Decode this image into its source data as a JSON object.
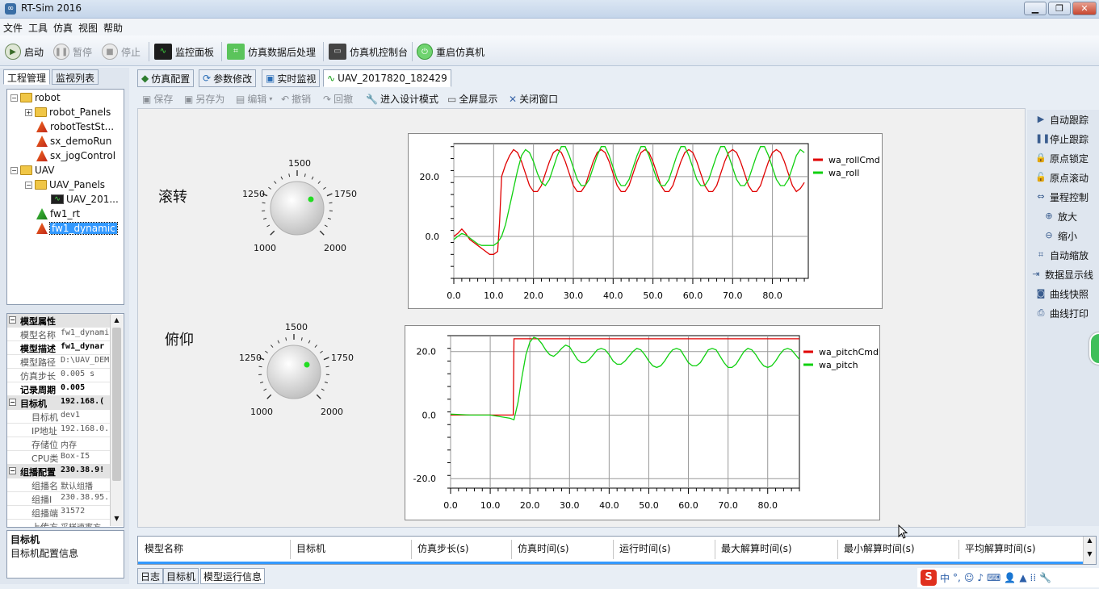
{
  "window": {
    "title": "RT-Sim 2016",
    "minimize": "▁",
    "restore": "❐",
    "close": "✕"
  },
  "menu": [
    "文件",
    "工具",
    "仿真",
    "视图",
    "帮助"
  ],
  "toolbar": {
    "start": "启动",
    "pause": "暂停",
    "stop": "停止",
    "monitor_panel": "监控面板",
    "postprocess": "仿真数据后处理",
    "console": "仿真机控制台",
    "restart": "重启仿真机"
  },
  "left_tabs": [
    "工程管理",
    "监视列表"
  ],
  "tree": {
    "robot": "robot",
    "robot_panels": "robot_Panels",
    "robot_test": "robotTestSt...",
    "sx_demo": "sx_demoRun",
    "sx_jog": "sx_jogControl",
    "uav": "UAV",
    "uav_panels": "UAV_Panels",
    "uav_201": "UAV_201...",
    "fw1_rt": "fw1_rt",
    "fw1_dynamic": "fw1_dynamic"
  },
  "props": [
    {
      "k": "模型属性",
      "v": "",
      "type": "grp"
    },
    {
      "k": "模型名称",
      "v": "fw1_dynami",
      "type": "n"
    },
    {
      "k": "模型描述",
      "v": "fw1_dynar",
      "type": "bold"
    },
    {
      "k": "模型路径",
      "v": "D:\\UAV_DEM",
      "type": "n"
    },
    {
      "k": "仿真步长",
      "v": "0.005 s",
      "type": "n"
    },
    {
      "k": "记录周期",
      "v": "0.005",
      "type": "bold"
    },
    {
      "k": "目标机",
      "v": "192.168.(",
      "type": "grp"
    },
    {
      "k": "目标机",
      "v": "dev1",
      "type": "n2"
    },
    {
      "k": "IP地址",
      "v": "192.168.0.",
      "type": "n2"
    },
    {
      "k": "存储位",
      "v": "内存",
      "type": "n2"
    },
    {
      "k": "CPU类",
      "v": "Box-I5",
      "type": "n2"
    },
    {
      "k": "组播配置",
      "v": "230.38.9!",
      "type": "grp"
    },
    {
      "k": "组播名",
      "v": "默认组播",
      "type": "n2"
    },
    {
      "k": "组播I",
      "v": "230.38.95.",
      "type": "n2"
    },
    {
      "k": "组播端",
      "v": "31572",
      "type": "n2"
    },
    {
      "k": "上传方",
      "v": "采样速率方",
      "type": "n2"
    }
  ],
  "desc": {
    "title": "目标机",
    "text": "目标机配置信息"
  },
  "main_tabs": [
    "仿真配置",
    "参数修改",
    "实时监视",
    "UAV_2017820_182429"
  ],
  "subtoolbar": {
    "save": "保存",
    "saveas": "另存为",
    "edit": "编辑",
    "undo": "撤销",
    "redo": "回撤",
    "design": "进入设计模式",
    "fullscreen": "全屏显示",
    "close": "关闭窗口"
  },
  "right_panel": [
    "自动跟踪",
    "停止跟踪",
    "原点锁定",
    "原点滚动",
    "量程控制",
    "放大",
    "缩小",
    "自动缩放",
    "数据显示线",
    "曲线快照",
    "曲线打印"
  ],
  "labels": {
    "roll": "滚转",
    "pitch": "俯仰"
  },
  "knob1": {
    "t": "1500",
    "l": "1250",
    "r": "1750",
    "bl": "1000",
    "br": "2000"
  },
  "knob2": {
    "t": "1500",
    "l": "1250",
    "r": "1750",
    "bl": "1000",
    "br": "2000"
  },
  "chart_data": [
    {
      "type": "line",
      "x_ticks": [
        0,
        10,
        20,
        30,
        40,
        50,
        60,
        70,
        80
      ],
      "y_ticks": [
        0,
        20
      ],
      "xlim": [
        0,
        89
      ],
      "ylim": [
        -14,
        31
      ],
      "legend": "top-right",
      "grid": true,
      "series": [
        {
          "name": "wa_rollCmd",
          "color": "#e00000",
          "x": [
            0,
            1,
            2,
            3,
            4,
            5,
            6,
            7,
            8,
            9,
            10,
            11,
            11.5,
            12,
            13,
            14,
            15,
            16,
            17,
            18,
            19,
            20,
            21,
            22,
            23,
            24,
            25,
            26,
            27,
            28,
            29,
            30,
            31,
            32,
            33,
            34,
            35,
            36,
            37,
            38,
            39,
            40,
            41,
            42,
            43,
            44,
            45,
            46,
            47,
            48,
            49,
            50,
            51,
            52,
            53,
            54,
            55,
            56,
            57,
            58,
            59,
            60,
            61,
            62,
            63,
            64,
            65,
            66,
            67,
            68,
            69,
            70,
            71,
            72,
            73,
            74,
            75,
            76,
            77,
            78,
            79,
            80,
            81,
            82,
            83,
            84,
            85,
            86,
            87,
            88
          ],
          "y": [
            0,
            1,
            2.5,
            1,
            -1,
            -2,
            -3,
            -4,
            -5,
            -6,
            -6,
            -5,
            5,
            20,
            24,
            27,
            29,
            28,
            25,
            21,
            17,
            15,
            15,
            17,
            21,
            25,
            28,
            29,
            28,
            25,
            21,
            17,
            15,
            15,
            17,
            21,
            25,
            28,
            29,
            28,
            25,
            21,
            17,
            15,
            15,
            17,
            21,
            25,
            28,
            29,
            28,
            25,
            21,
            17,
            15,
            15,
            17,
            21,
            25,
            28,
            29,
            28,
            25,
            21,
            17,
            15,
            15,
            17,
            21,
            25,
            28,
            29,
            28,
            25,
            21,
            17,
            15,
            15,
            17,
            21,
            25,
            28,
            29,
            28,
            25,
            21,
            17,
            15,
            16,
            18
          ]
        },
        {
          "name": "wa_roll",
          "color": "#10d010",
          "x": [
            0,
            1,
            2,
            3,
            4,
            5,
            6,
            7,
            8,
            9,
            10,
            11,
            12,
            13,
            14,
            15,
            16,
            17,
            18,
            19,
            20,
            21,
            22,
            23,
            24,
            25,
            26,
            27,
            28,
            29,
            30,
            31,
            32,
            33,
            34,
            35,
            36,
            37,
            38,
            39,
            40,
            41,
            42,
            43,
            44,
            45,
            46,
            47,
            48,
            49,
            50,
            51,
            52,
            53,
            54,
            55,
            56,
            57,
            58,
            59,
            60,
            61,
            62,
            63,
            64,
            65,
            66,
            67,
            68,
            69,
            70,
            71,
            72,
            73,
            74,
            75,
            76,
            77,
            78,
            79,
            80,
            81,
            82,
            83,
            84,
            85,
            86,
            87,
            88
          ],
          "y": [
            -1,
            0,
            1,
            0.5,
            -0.5,
            -1.5,
            -2.5,
            -3,
            -3,
            -3,
            -3,
            -2,
            0,
            4,
            10,
            16,
            22,
            27,
            29,
            28,
            25,
            21,
            18,
            17,
            19,
            23,
            27,
            30,
            30,
            27,
            23,
            19,
            17,
            17,
            19,
            23,
            27,
            30,
            30,
            27,
            23,
            19,
            17,
            17,
            19,
            23,
            27,
            30,
            30,
            27,
            23,
            19,
            17,
            17,
            19,
            23,
            27,
            30,
            30,
            27,
            23,
            19,
            17,
            17,
            19,
            23,
            27,
            30,
            30,
            27,
            23,
            19,
            17,
            17,
            19,
            23,
            27,
            30,
            30,
            27,
            23,
            19,
            17,
            17,
            19,
            23,
            27,
            29,
            28
          ]
        }
      ]
    },
    {
      "type": "line",
      "x_ticks": [
        0,
        10,
        20,
        30,
        40,
        50,
        60,
        70,
        80
      ],
      "y_ticks": [
        -20,
        0,
        20
      ],
      "xlim": [
        0,
        88
      ],
      "ylim": [
        -23,
        25
      ],
      "legend": "top-right",
      "grid": true,
      "series": [
        {
          "name": "wa_pitchCmd",
          "color": "#e00000",
          "x": [
            0,
            15.8,
            16,
            88
          ],
          "y": [
            0,
            0,
            24,
            24
          ]
        },
        {
          "name": "wa_pitch",
          "color": "#10d010",
          "x": [
            0,
            5,
            10,
            15,
            16,
            17,
            18,
            19,
            20,
            21,
            22,
            23,
            24,
            25,
            26,
            27,
            28,
            29,
            30,
            31,
            32,
            33,
            34,
            35,
            36,
            37,
            38,
            39,
            40,
            41,
            42,
            43,
            44,
            45,
            46,
            47,
            48,
            49,
            50,
            51,
            52,
            53,
            54,
            55,
            56,
            57,
            58,
            59,
            60,
            61,
            62,
            63,
            64,
            65,
            66,
            67,
            68,
            69,
            70,
            71,
            72,
            73,
            74,
            75,
            76,
            77,
            78,
            79,
            80,
            81,
            82,
            83,
            84,
            85,
            86,
            87,
            88
          ],
          "y": [
            0.3,
            0,
            0,
            -1,
            -1.5,
            4,
            12,
            19,
            23,
            24.5,
            24,
            22.5,
            20.5,
            19,
            18.5,
            19.5,
            21,
            22,
            21.5,
            19.5,
            17.5,
            16.5,
            16.5,
            17.5,
            19,
            20.5,
            21,
            20.5,
            19,
            17,
            16,
            16,
            17,
            18.5,
            20,
            21,
            20.5,
            19,
            17,
            15.5,
            15,
            15.5,
            17,
            19,
            20.5,
            21,
            20.5,
            18.5,
            16.5,
            15.5,
            15.5,
            16.5,
            18.5,
            20.5,
            21,
            20.5,
            18.5,
            16.5,
            15,
            15,
            16,
            18,
            20,
            21,
            20.5,
            19,
            17,
            15.5,
            15,
            15.5,
            17,
            19,
            20.5,
            21,
            20.5,
            19,
            17.5
          ]
        }
      ]
    }
  ],
  "bottom_table_headers": [
    "模型名称",
    "目标机",
    "仿真步长(s)",
    "仿真时间(s)",
    "运行时间(s)",
    "最大解算时间(s)",
    "最小解算时间(s)",
    "平均解算时间(s)"
  ],
  "bottom_tabs": [
    "日志",
    "目标机",
    "模型运行信息"
  ],
  "ime": {
    "brand": "S",
    "lang": "中"
  }
}
